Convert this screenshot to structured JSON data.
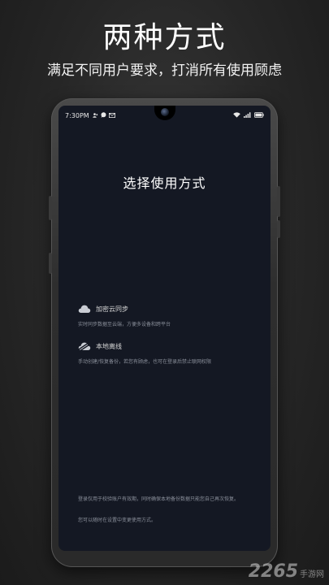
{
  "promo": {
    "title": "两种方式",
    "subtitle": "满足不同用户要求，打消所有使用顾虑"
  },
  "status_bar": {
    "time": "7:30PM",
    "left_icons": [
      "contacts-icon",
      "chat-bubble-icon",
      "mail-icon"
    ],
    "right_icons": [
      "wifi-icon",
      "signal-icon",
      "battery-icon"
    ]
  },
  "screen": {
    "title": "选择使用方式",
    "options": [
      {
        "icon": "cloud-icon",
        "label": "加密云同步",
        "description": "实时同步数据至云端，方便多设备和跨平台"
      },
      {
        "icon": "local-disk-icon",
        "label": "本地离线",
        "description": "手动创建/恢复备份，若您有顾虑，也可在登录后禁止联网权限"
      }
    ],
    "notes": [
      "登录仅用于校验账户有效期，同时确保本地备份数据只能您自己再次恢复。",
      "您可以随时在设置中变更使用方式。"
    ]
  },
  "watermark": {
    "number": "2265",
    "text": "手游网"
  }
}
